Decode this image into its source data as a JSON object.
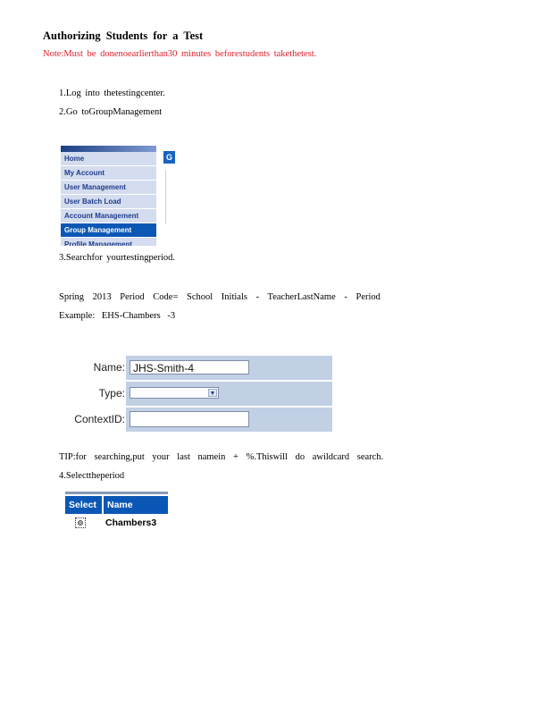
{
  "doc": {
    "title": "Authorizing Students for a Test",
    "note": "Note:Must be donenoearlierthan30 minutes beforestudents takethetest.",
    "step1": "1.Log into thetestingcenter.",
    "step2": "2.Go toGroupManagement",
    "step3": "3.Searchfor yourtestingperiod.",
    "period_code_line": "Spring 2013 Period Code= School Initials - TeacherLastName - Period",
    "example_line": "Example: EHS-Chambers -3",
    "tip": "TIP:for searching,put your last namein + %.Thiswill do awildcard search.",
    "step4": "4.Selecttheperiod"
  },
  "nav": {
    "items": [
      "Home",
      "My Account",
      "User Management",
      "User Batch Load",
      "Account Management",
      "Group Management",
      "Profile Management"
    ],
    "active_index": 5,
    "side_tab": "G"
  },
  "search_form": {
    "name_label": "Name:",
    "name_value": "JHS-Smith-4",
    "type_label": "Type:",
    "type_value": "",
    "contextid_label": "ContextID:",
    "contextid_value": ""
  },
  "results": {
    "headers": [
      "Select",
      "Name"
    ],
    "rows": [
      {
        "name": "Chambers3"
      }
    ]
  },
  "colors": {
    "note_red": "#e0202a",
    "nav_blue": "#0b57b6",
    "form_bg": "#c2d0e6"
  }
}
